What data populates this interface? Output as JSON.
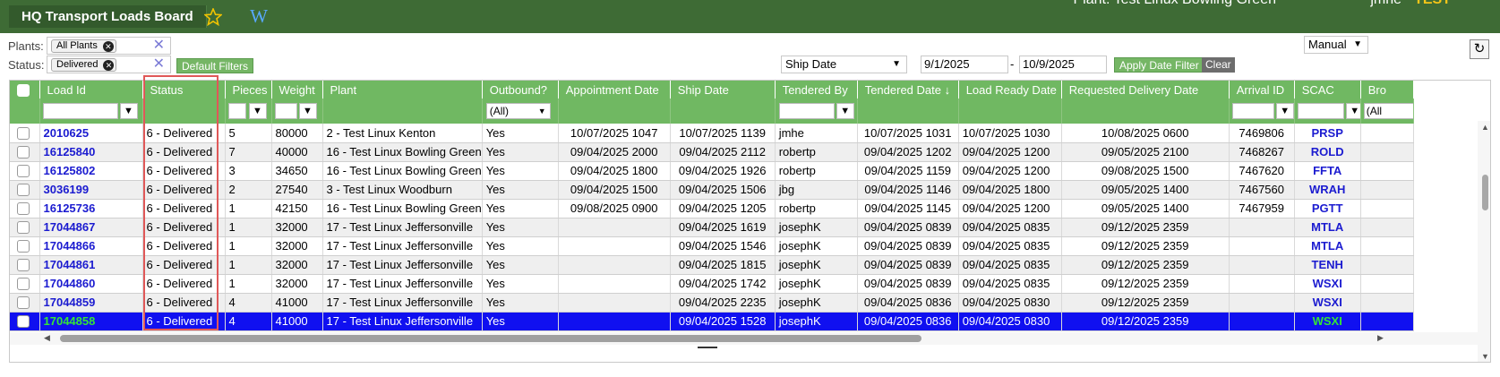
{
  "app": {
    "title": "HQ Transport Loads Board",
    "star_icon": "star-icon",
    "w_icon_letter": "W",
    "user_location": "Plant: Test Linux Bowling Green",
    "user_name": "jmhe",
    "env_label": "TEST"
  },
  "filters": {
    "plants_label": "Plants:",
    "plants_chip": "All Plants",
    "status_label": "Status:",
    "status_chip": "Delivered",
    "default_filters_label": "Default Filters",
    "date_field": "Ship Date",
    "date_from": "9/1/2025",
    "date_sep": "-",
    "date_to": "10/9/2025",
    "apply_date_label": "Apply Date Filter",
    "clear_label": "Clear",
    "mode": "Manual",
    "refresh_icon": "refresh-icon"
  },
  "grid": {
    "columns": [
      "Load Id",
      "Status",
      "Pieces",
      "Weight",
      "Plant",
      "Outbound?",
      "Appointment Date",
      "Ship Date",
      "Tendered By",
      "Tendered Date ↓",
      "Load Ready Date",
      "Requested Delivery Date",
      "Arrival ID",
      "SCAC",
      "Bro"
    ],
    "outbound_filter": "(All)",
    "last_filter": "(All",
    "rows": [
      {
        "load_id": "2010625",
        "status": "6 - Delivered",
        "pieces": "5",
        "weight": "80000",
        "plant": "2 - Test Linux Kenton",
        "outbound": "Yes",
        "appointment": "10/07/2025 1047",
        "ship": "10/07/2025 1139",
        "tendered_by": "jmhe",
        "tendered_date": "10/07/2025 1031",
        "load_ready": "10/07/2025 1030",
        "requested": "10/08/2025 0600",
        "arrival": "7469806",
        "scac": "PRSP"
      },
      {
        "load_id": "16125840",
        "status": "6 - Delivered",
        "pieces": "7",
        "weight": "40000",
        "plant": "16 - Test Linux Bowling Green",
        "outbound": "Yes",
        "appointment": "09/04/2025 2000",
        "ship": "09/04/2025 2112",
        "tendered_by": "robertp",
        "tendered_date": "09/04/2025 1202",
        "load_ready": "09/04/2025 1200",
        "requested": "09/05/2025 2100",
        "arrival": "7468267",
        "scac": "ROLD"
      },
      {
        "load_id": "16125802",
        "status": "6 - Delivered",
        "pieces": "3",
        "weight": "34650",
        "plant": "16 - Test Linux Bowling Green",
        "outbound": "Yes",
        "appointment": "09/04/2025 1800",
        "ship": "09/04/2025 1926",
        "tendered_by": "robertp",
        "tendered_date": "09/04/2025 1159",
        "load_ready": "09/04/2025 1200",
        "requested": "09/08/2025 1500",
        "arrival": "7467620",
        "scac": "FFTA"
      },
      {
        "load_id": "3036199",
        "status": "6 - Delivered",
        "pieces": "2",
        "weight": "27540",
        "plant": "3 - Test Linux Woodburn",
        "outbound": "Yes",
        "appointment": "09/04/2025 1500",
        "ship": "09/04/2025 1506",
        "tendered_by": "jbg",
        "tendered_date": "09/04/2025 1146",
        "load_ready": "09/04/2025 1800",
        "requested": "09/05/2025 1400",
        "arrival": "7467560",
        "scac": "WRAH"
      },
      {
        "load_id": "16125736",
        "status": "6 - Delivered",
        "pieces": "1",
        "weight": "42150",
        "plant": "16 - Test Linux Bowling Green",
        "outbound": "Yes",
        "appointment": "09/08/2025 0900",
        "ship": "09/04/2025 1205",
        "tendered_by": "robertp",
        "tendered_date": "09/04/2025 1145",
        "load_ready": "09/04/2025 1200",
        "requested": "09/05/2025 1400",
        "arrival": "7467959",
        "scac": "PGTT"
      },
      {
        "load_id": "17044867",
        "status": "6 - Delivered",
        "pieces": "1",
        "weight": "32000",
        "plant": "17 - Test Linux Jeffersonville",
        "outbound": "Yes",
        "appointment": "",
        "ship": "09/04/2025 1619",
        "tendered_by": "josephK",
        "tendered_date": "09/04/2025 0839",
        "load_ready": "09/04/2025 0835",
        "requested": "09/12/2025 2359",
        "arrival": "",
        "scac": "MTLA"
      },
      {
        "load_id": "17044866",
        "status": "6 - Delivered",
        "pieces": "1",
        "weight": "32000",
        "plant": "17 - Test Linux Jeffersonville",
        "outbound": "Yes",
        "appointment": "",
        "ship": "09/04/2025 1546",
        "tendered_by": "josephK",
        "tendered_date": "09/04/2025 0839",
        "load_ready": "09/04/2025 0835",
        "requested": "09/12/2025 2359",
        "arrival": "",
        "scac": "MTLA"
      },
      {
        "load_id": "17044861",
        "status": "6 - Delivered",
        "pieces": "1",
        "weight": "32000",
        "plant": "17 - Test Linux Jeffersonville",
        "outbound": "Yes",
        "appointment": "",
        "ship": "09/04/2025 1815",
        "tendered_by": "josephK",
        "tendered_date": "09/04/2025 0839",
        "load_ready": "09/04/2025 0835",
        "requested": "09/12/2025 2359",
        "arrival": "",
        "scac": "TENH"
      },
      {
        "load_id": "17044860",
        "status": "6 - Delivered",
        "pieces": "1",
        "weight": "32000",
        "plant": "17 - Test Linux Jeffersonville",
        "outbound": "Yes",
        "appointment": "",
        "ship": "09/04/2025 1742",
        "tendered_by": "josephK",
        "tendered_date": "09/04/2025 0839",
        "load_ready": "09/04/2025 0835",
        "requested": "09/12/2025 2359",
        "arrival": "",
        "scac": "WSXI"
      },
      {
        "load_id": "17044859",
        "status": "6 - Delivered",
        "pieces": "4",
        "weight": "41000",
        "plant": "17 - Test Linux Jeffersonville",
        "outbound": "Yes",
        "appointment": "",
        "ship": "09/04/2025 2235",
        "tendered_by": "josephK",
        "tendered_date": "09/04/2025 0836",
        "load_ready": "09/04/2025 0830",
        "requested": "09/12/2025 2359",
        "arrival": "",
        "scac": "WSXI"
      },
      {
        "load_id": "17044858",
        "status": "6 - Delivered",
        "pieces": "4",
        "weight": "41000",
        "plant": "17 - Test Linux Jeffersonville",
        "outbound": "Yes",
        "appointment": "",
        "ship": "09/04/2025 1528",
        "tendered_by": "josephK",
        "tendered_date": "09/04/2025 0836",
        "load_ready": "09/04/2025 0830",
        "requested": "09/12/2025 2359",
        "arrival": "",
        "scac": "WSXI"
      }
    ],
    "selected_row_index": 10
  },
  "colors": {
    "topbar": "#3e6b35",
    "header_green": "#70b862",
    "selected_row": "#1010f0",
    "link_blue": "#1b1bd0",
    "highlight_red": "#e05858"
  }
}
